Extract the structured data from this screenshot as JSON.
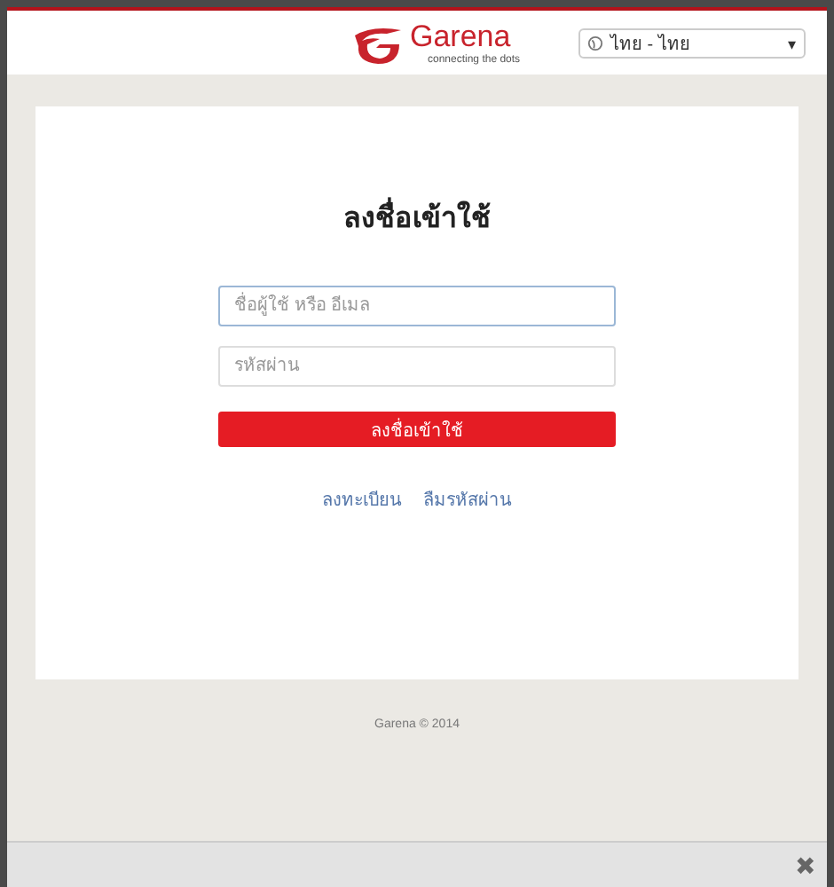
{
  "header": {
    "logo": "Garena",
    "tagline": "connecting the dots",
    "language": "ไทย - ไทย",
    "dropdown_caret": "▾"
  },
  "login": {
    "title": "ลงชื่อเข้าใช้",
    "username": {
      "placeholder": "ชื่อผู้ใช้ หรือ อีเมล"
    },
    "password": {
      "placeholder": "รหัสผ่าน"
    },
    "submit": "ลงชื่อเข้าใช้",
    "links": [
      "ลงทะเบียน",
      "ลืมรหัสผ่าน"
    ]
  },
  "footer": "Garena © 2014",
  "close": "✖"
}
